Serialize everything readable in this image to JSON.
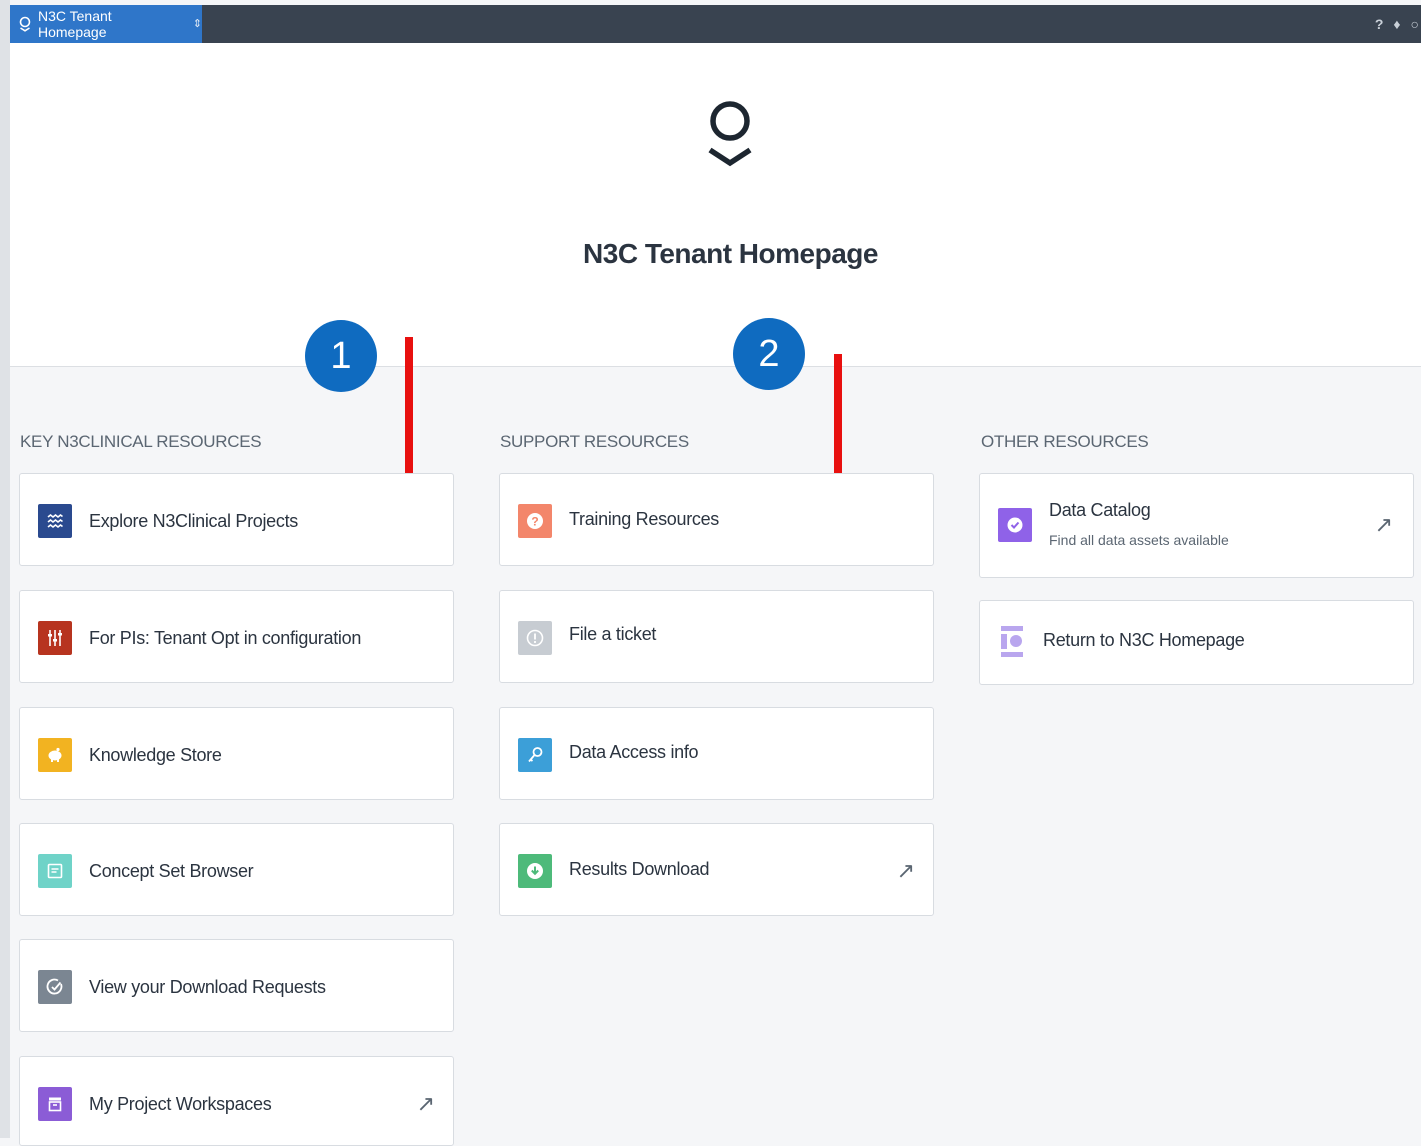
{
  "topbar": {
    "tab_label": "N3C Tenant Homepage",
    "tab_chevron": "⇕",
    "icons": [
      "help-icon",
      "notification-bell-icon",
      "user-account-icon"
    ]
  },
  "hero": {
    "logo": "palantir-logo-icon",
    "title": "N3C Tenant Homepage"
  },
  "markers": [
    "1",
    "2"
  ],
  "sections": {
    "key": {
      "title": "KEY N3CLINICAL RESOURCES",
      "items": [
        {
          "label": "Explore N3Clinical Projects",
          "icon": "waves-icon",
          "color": "#2a4a8f"
        },
        {
          "label": "For PIs: Tenant Opt in configuration",
          "icon": "sliders-icon",
          "color": "#b7341f"
        },
        {
          "label": "Knowledge Store",
          "icon": "piggy-bank-icon",
          "color": "#f2b321"
        },
        {
          "label": "Concept Set Browser",
          "icon": "document-icon",
          "color": "#6fd3c8"
        },
        {
          "label": "View your Download Requests",
          "icon": "check-circle-icon",
          "color": "#7b8692"
        },
        {
          "label": "My Project Workspaces",
          "icon": "archive-icon",
          "color": "#8b5cd6"
        }
      ]
    },
    "support": {
      "title": "SUPPORT RESOURCES",
      "items": [
        {
          "label": "Training Resources",
          "icon": "question-icon",
          "color": "#f3866b"
        },
        {
          "label": "File a ticket",
          "icon": "info-icon",
          "color": "#c7ccd2"
        },
        {
          "label": "Data Access info",
          "icon": "key-icon",
          "color": "#3c9fd8"
        },
        {
          "label": "Results Download",
          "icon": "download-icon",
          "color": "#4dba7a"
        }
      ]
    },
    "other": {
      "title": "OTHER RESOURCES",
      "items": [
        {
          "label": "Data Catalog",
          "sub": "Find all data assets available",
          "icon": "verified-badge-icon",
          "color": "#8f62e8"
        },
        {
          "label": "Return to N3C Homepage",
          "icon": "layout-icon",
          "color": "#b9a6ee"
        }
      ]
    }
  },
  "external_link_glyph": "↗",
  "colors": {
    "topbar": "#394350",
    "tab": "#2f76c9",
    "marker": "#0f6bc0",
    "arrow": "#e8100f",
    "background": "#f5f6f8"
  }
}
